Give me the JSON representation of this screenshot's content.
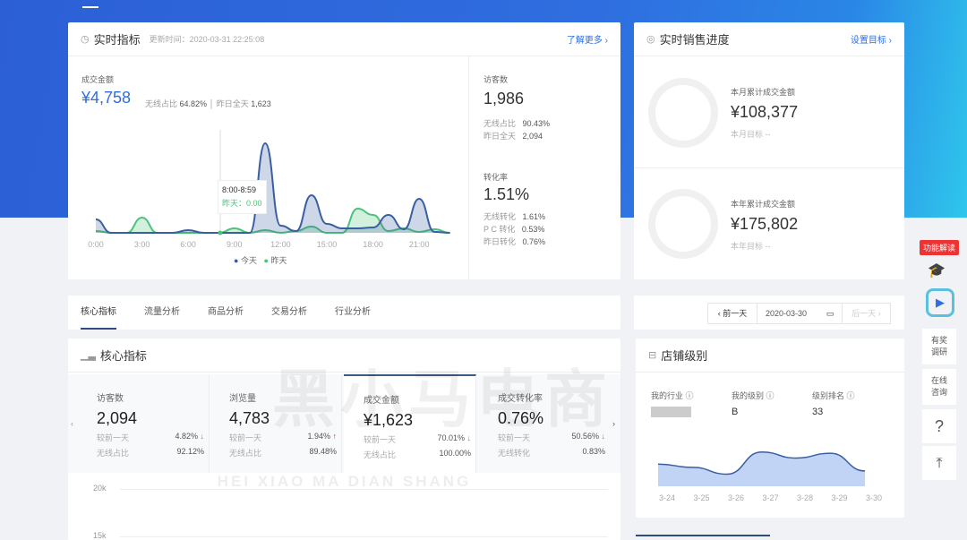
{
  "realtime": {
    "title": "实时指标",
    "updated": "更新时间：2020-03-31 22:25:08",
    "more": "了解更多 ›",
    "gmv_label": "成交金额",
    "gmv": "¥4,758",
    "wireless_label": "无线占比",
    "wireless": "64.82%",
    "yesterday_label": "昨日全天",
    "yesterday": "1,623",
    "visitors_label": "访客数",
    "visitors": "1,986",
    "v_wireless_label": "无线占比",
    "v_wireless": "90.43%",
    "v_yest_label": "昨日全天",
    "v_yest": "2,094",
    "cvr_label": "转化率",
    "cvr": "1.51%",
    "cvr_rows": [
      {
        "label": "无线转化",
        "value": "1.61%"
      },
      {
        "label": "P C 转化",
        "value": "0.53%"
      },
      {
        "label": "昨日转化",
        "value": "0.76%"
      }
    ],
    "tooltip_time": "8:00-8:59",
    "tooltip_value": "昨天：0.00"
  },
  "sales": {
    "title": "实时销售进度",
    "set_goal": "设置目标 ›",
    "month_label": "本月累计成交金额",
    "month": "¥108,377",
    "month_goal": "本月目标 --",
    "year_label": "本年累计成交金额",
    "year": "¥175,802",
    "year_goal": "本年目标 --"
  },
  "tabs": [
    "核心指标",
    "流量分析",
    "商品分析",
    "交易分析",
    "行业分析"
  ],
  "date": {
    "prev": "‹ 前一天",
    "value": "2020-03-30",
    "next": "后一天 ›"
  },
  "core": {
    "title": "核心指标",
    "metrics": [
      {
        "label": "访客数",
        "value": "2,094",
        "cmp_label": "较前一天",
        "cmp": "4.82%",
        "dir": "down",
        "sub_label": "无线占比",
        "sub": "92.12%"
      },
      {
        "label": "浏览量",
        "value": "4,783",
        "cmp_label": "较前一天",
        "cmp": "1.94%",
        "dir": "up",
        "sub_label": "无线占比",
        "sub": "89.48%"
      },
      {
        "label": "成交金额",
        "value": "¥1,623",
        "cmp_label": "较前一天",
        "cmp": "70.01%",
        "dir": "down",
        "sub_label": "无线占比",
        "sub": "100.00%"
      },
      {
        "label": "成交转化率",
        "value": "0.76%",
        "cmp_label": "较前一天",
        "cmp": "50.56%",
        "dir": "down",
        "sub_label": "无线转化",
        "sub": "0.83%"
      }
    ]
  },
  "store": {
    "title": "店铺级别",
    "industry_label": "我的行业",
    "level_label": "我的级别",
    "level": "B",
    "rank_label": "级别排名",
    "rank": "33"
  },
  "side": {
    "badge": "功能解读",
    "survey": "有奖调研",
    "consult": "在线咨询",
    "help": "?",
    "top": "⤒"
  },
  "watermark": {
    "cn": "黑小马电商",
    "en": "HEI XIAO MA DIAN SHANG"
  },
  "chart_data": [
    {
      "type": "area",
      "x": [
        "0:00",
        "3:00",
        "6:00",
        "9:00",
        "12:00",
        "15:00",
        "18:00",
        "21:00"
      ],
      "hours": [
        0,
        1,
        2,
        3,
        4,
        5,
        6,
        7,
        8,
        9,
        10,
        11,
        12,
        13,
        14,
        15,
        16,
        17,
        18,
        19,
        20,
        21,
        22,
        23
      ],
      "series": [
        {
          "name": "今天",
          "color": "#3a5fa0",
          "values": [
            0.15,
            0,
            0,
            0,
            0,
            0,
            0.03,
            0,
            0,
            0,
            0,
            1.0,
            0.08,
            0.02,
            0.42,
            0.1,
            0.05,
            0.05,
            0.06,
            0.2,
            0.04,
            0.38,
            0.01,
            0
          ]
        },
        {
          "name": "昨天",
          "color": "#4cc27a",
          "values": [
            0.02,
            0,
            0,
            0.17,
            0,
            0,
            0,
            0,
            0,
            0.05,
            0,
            0.03,
            0,
            0.02,
            0.07,
            0,
            0,
            0.27,
            0.2,
            0.02,
            0.05,
            0.01,
            0.04,
            0
          ]
        }
      ]
    },
    {
      "type": "area",
      "categories": [
        "3-24",
        "3-25",
        "3-26",
        "3-27",
        "3-28",
        "3-29",
        "3-30"
      ],
      "values": [
        0.55,
        0.47,
        0.3,
        0.85,
        0.7,
        0.82,
        0.38
      ]
    },
    {
      "type": "line",
      "yticks": [
        "20k",
        "15k"
      ]
    }
  ]
}
